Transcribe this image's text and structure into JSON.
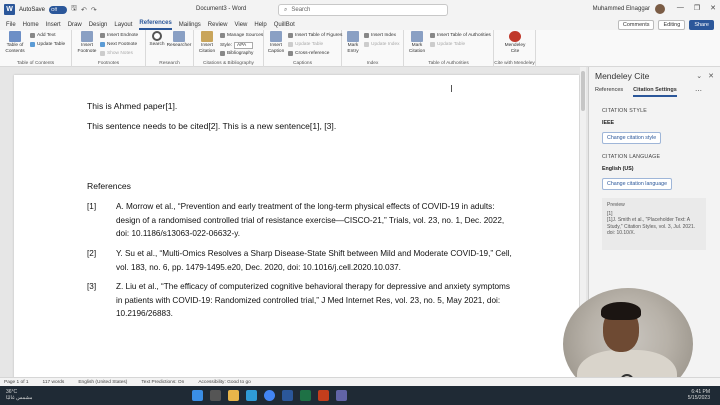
{
  "titlebar": {
    "app_icon": "W",
    "autosave_label": "AutoSave",
    "autosave_state": "Off",
    "doc_title": "Document3 - Word",
    "search_placeholder": "Search",
    "user_name": "Muhammed Elnaggar",
    "controls": [
      "—",
      "❐",
      "✕"
    ]
  },
  "tabs": [
    "File",
    "Home",
    "Insert",
    "Draw",
    "Design",
    "Layout",
    "References",
    "Mailings",
    "Review",
    "View",
    "Help",
    "QuillBot"
  ],
  "active_tab": "References",
  "tab_buttons": {
    "comments": "Comments",
    "editing": "Editing",
    "share": "Share"
  },
  "ribbon": {
    "toc": {
      "big": "Table of Contents",
      "add_text": "Add Text",
      "update_table": "Update Table",
      "group": "Table of Contents"
    },
    "footnotes": {
      "big": "Insert Footnote",
      "insert_endnote": "Insert Endnote",
      "next_footnote": "Next Footnote",
      "show_notes": "Show Notes",
      "group": "Footnotes"
    },
    "research": {
      "search": "Search",
      "researcher": "Researcher",
      "group": "Research"
    },
    "citations": {
      "big": "Insert Citation",
      "manage_sources": "Manage Sources",
      "style_label": "Style:",
      "style_value": "APA",
      "bibliography": "Bibliography",
      "group": "Citations & Bibliography"
    },
    "captions": {
      "big": "Insert Caption",
      "insert_tof": "Insert Table of Figures",
      "update_table": "Update Table",
      "cross_ref": "Cross-reference",
      "group": "Captions"
    },
    "index": {
      "big": "Mark Entry",
      "insert_index": "Insert Index",
      "update_index": "Update Index",
      "group": "Index"
    },
    "toa": {
      "big": "Mark Citation",
      "insert_toa": "Insert Table of Authorities",
      "update_table": "Update Table",
      "group": "Table of Authorities"
    },
    "mendeley": {
      "big": "Mendeley Cite",
      "group": "Cite with Mendeley"
    }
  },
  "document": {
    "line1": "This is Ahmed paper[1].",
    "line2": "This sentence needs to be cited[2]. This is a new sentence[1], [3].",
    "references_heading": "References",
    "references": [
      {
        "num": "[1]",
        "text": "A. Morrow et al., “Prevention and early treatment of the long-term physical effects of COVID-19 in adults: design of a randomised controlled trial of resistance exercise—CISCO-21,” Trials, vol. 23, no. 1, Dec. 2022, doi: 10.1186/s13063-022-06632-y."
      },
      {
        "num": "[2]",
        "text": "Y. Su et al., “Multi-Omics Resolves a Sharp Disease-State Shift between Mild and Moderate COVID-19,” Cell, vol. 183, no. 6, pp. 1479-1495.e20, Dec. 2020, doi: 10.1016/j.cell.2020.10.037."
      },
      {
        "num": "[3]",
        "text": "Z. Liu et al., “The efficacy of computerized cognitive behavioral therapy for depressive and anxiety symptoms in patients with COVID-19: Randomized controlled trial,” J Med Internet Res, vol. 23, no. 5, May 2021, doi: 10.2196/26883."
      }
    ]
  },
  "pane": {
    "title": "Mendeley Cite",
    "tabs": [
      "References",
      "Citation Settings"
    ],
    "active_tab": "Citation Settings",
    "citation_style_heading": "CITATION STYLE",
    "citation_style_value": "IEEE",
    "change_style_btn": "Change citation style",
    "citation_language_heading": "CITATION LANGUAGE",
    "citation_language_value": "English (US)",
    "change_language_btn": "Change citation language",
    "preview_label": "Preview",
    "preview_num": "[1]",
    "preview_text": "[1]J. Smith et al., \"Placeholder Text: A Study,\" Citation Styles, vol. 3, Jul. 2021. doi: 10.10/X."
  },
  "status": {
    "page": "Page 1 of 1",
    "words": "117 words",
    "language": "English (United States)",
    "text_predictions": "Text Predictions: On",
    "accessibility": "Accessibility: Good to go"
  },
  "taskbar": {
    "weather_temp": "36°C",
    "weather_desc": "مشمس غالبًا",
    "time": "6:41 PM",
    "date": "5/15/2023"
  },
  "colors": {
    "accent": "#2b579a",
    "taskbar": "#1f2a35"
  }
}
